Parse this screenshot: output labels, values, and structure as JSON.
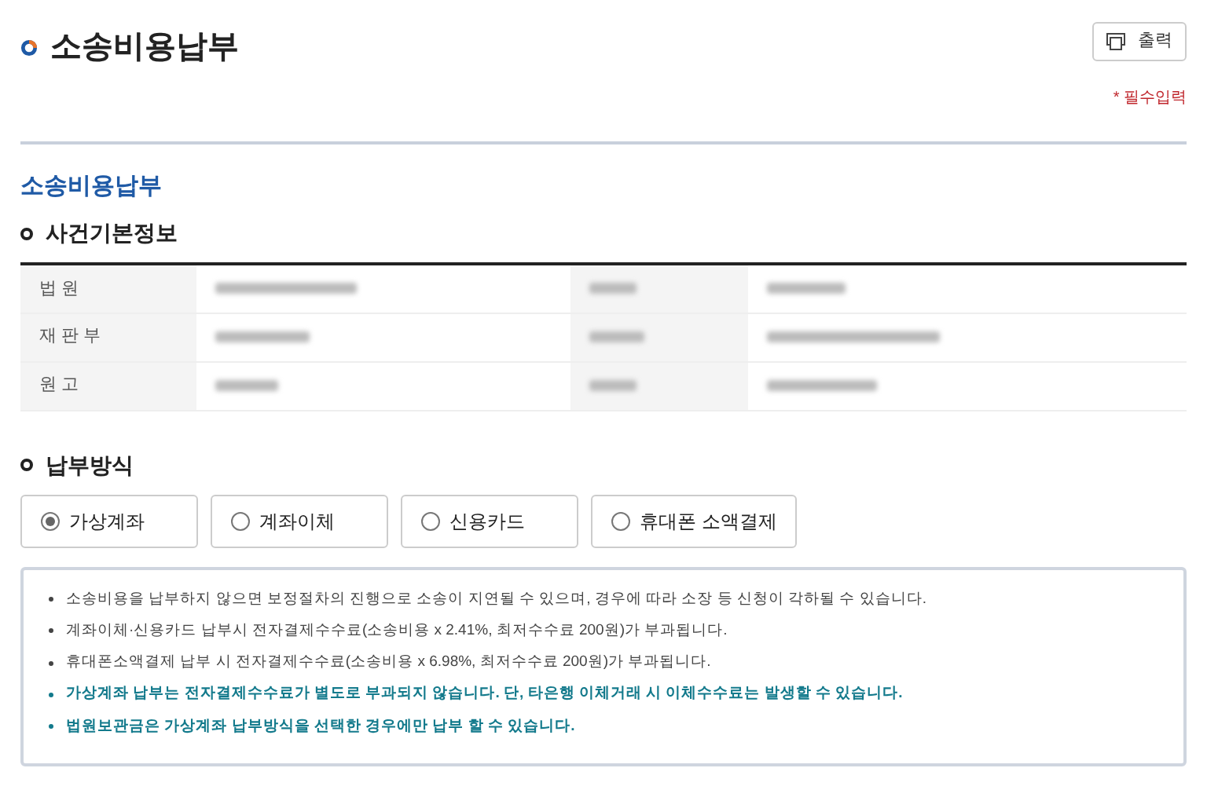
{
  "page_title": "소송비용납부",
  "print_button": "출력",
  "required_note": "* 필수입력",
  "section_title": "소송비용납부",
  "case_info": {
    "heading": "사건기본정보",
    "rows": [
      {
        "label": "법 원",
        "value_redacted": true,
        "label_2_redacted": true,
        "value_2_redacted": true
      },
      {
        "label": "재 판 부",
        "value_redacted": true,
        "label_2_redacted": true,
        "value_2_redacted": true
      },
      {
        "label": "원 고",
        "value_redacted": true,
        "label_2_redacted": true,
        "value_2_redacted": true
      }
    ]
  },
  "payment": {
    "heading": "납부방식",
    "options": [
      {
        "label": "가상계좌",
        "selected": true
      },
      {
        "label": "계좌이체",
        "selected": false
      },
      {
        "label": "신용카드",
        "selected": false
      },
      {
        "label": "휴대폰 소액결제",
        "selected": false
      }
    ]
  },
  "notes": [
    {
      "kind": "normal",
      "text": "소송비용을 납부하지 않으면 보정절차의 진행으로 소송이 지연될 수 있으며, 경우에 따라 소장 등 신청이 각하될 수 있습니다."
    },
    {
      "kind": "normal",
      "text": "계좌이체·신용카드 납부시 전자결제수수료(소송비용 x 2.41%, 최저수수료 200원)가 부과됩니다."
    },
    {
      "kind": "normal",
      "text": "휴대폰소액결제 납부 시 전자결제수수료(소송비용 x 6.98%, 최저수수료 200원)가 부과됩니다."
    },
    {
      "kind": "emphasis",
      "text": "가상계좌 납부는 전자결제수수료가 별도로 부과되지 않습니다. 단, 타은행 이체거래 시 이체수수료는 발생할 수 있습니다."
    },
    {
      "kind": "emphasis",
      "text": "법원보관금은 가상계좌 납부방식을 선택한 경우에만 납부 할 수 있습니다."
    }
  ]
}
